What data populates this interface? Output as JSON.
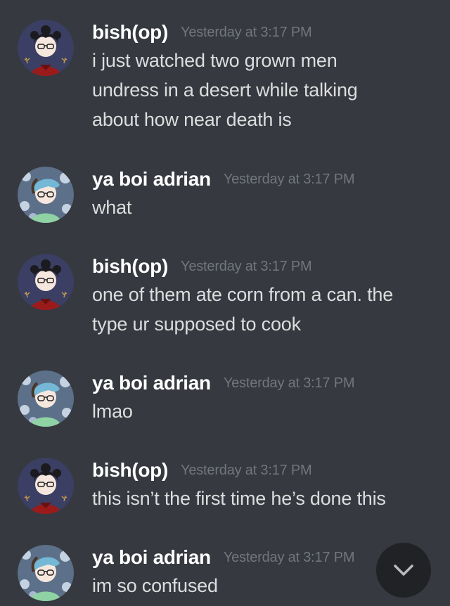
{
  "messages": [
    {
      "author": "bish(op)",
      "avatar": "bish-avatar",
      "timestamp": "Yesterday at 3:17 PM",
      "lines": [
        "i just watched two grown men",
        "undress in a desert while talking",
        "about how near death is"
      ]
    },
    {
      "author": "ya boi adrian",
      "avatar": "adrian-avatar",
      "timestamp": "Yesterday at 3:17 PM",
      "lines": [
        "what"
      ]
    },
    {
      "author": "bish(op)",
      "avatar": "bish-avatar",
      "timestamp": "Yesterday at 3:17 PM",
      "lines": [
        "one of them ate corn from a can. the",
        "type ur supposed to cook"
      ]
    },
    {
      "author": "ya boi adrian",
      "avatar": "adrian-avatar",
      "timestamp": "Yesterday at 3:17 PM",
      "lines": [
        "lmao"
      ]
    },
    {
      "author": "bish(op)",
      "avatar": "bish-avatar",
      "timestamp": "Yesterday at 3:17 PM",
      "lines": [
        "this isn’t the first time he’s done this"
      ]
    },
    {
      "author": "ya boi adrian",
      "avatar": "adrian-avatar",
      "timestamp": "Yesterday at 3:17 PM",
      "lines": [
        "im so confused"
      ]
    }
  ],
  "jump_button": {
    "icon": "chevron-down-icon"
  },
  "colors": {
    "background": "#36393f",
    "username": "#ffffff",
    "message_text": "#dcddde",
    "timestamp": "#72767d",
    "jump_button": "#202225"
  }
}
